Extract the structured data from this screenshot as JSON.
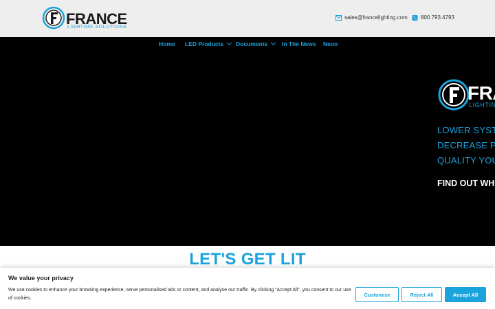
{
  "brand": {
    "name": "FRANCE",
    "tagline": "LIGHTING SOLUTIONS"
  },
  "contact": {
    "email": "sales@francelighting.com",
    "phone": "800.793.4793",
    "email_icon": "envelope-icon",
    "phone_icon": "phone-icon"
  },
  "nav": {
    "items": [
      {
        "label": "Home",
        "has_dropdown": false
      },
      {
        "label": "LED Products",
        "has_dropdown": true
      },
      {
        "label": "Documents",
        "has_dropdown": true
      },
      {
        "label": "In The News",
        "has_dropdown": false
      },
      {
        "label": "Neon",
        "has_dropdown": false
      }
    ]
  },
  "hero": {
    "logo_word": "FRA",
    "logo_sub": "LIGHTING",
    "lines": [
      "LOWER SYSTEM",
      "DECREASE PRO",
      "QUALITY YOU C"
    ],
    "cta": "FIND OUT WHY"
  },
  "section": {
    "title": "LET'S GET LIT"
  },
  "cookie_banner": {
    "title": "We value your privacy",
    "text": "We use cookies to enhance your browsing experience, serve personalised ads or content, and analyse our traffic. By clicking \"Accept All\", you consent to our use of cookies.",
    "customise_label": "Customise",
    "reject_label": "Reject All",
    "accept_label": "Accept All"
  },
  "colors": {
    "accent": "#1aa3dc",
    "header_bg": "#eeeeee",
    "hero_bg": "#000000"
  }
}
